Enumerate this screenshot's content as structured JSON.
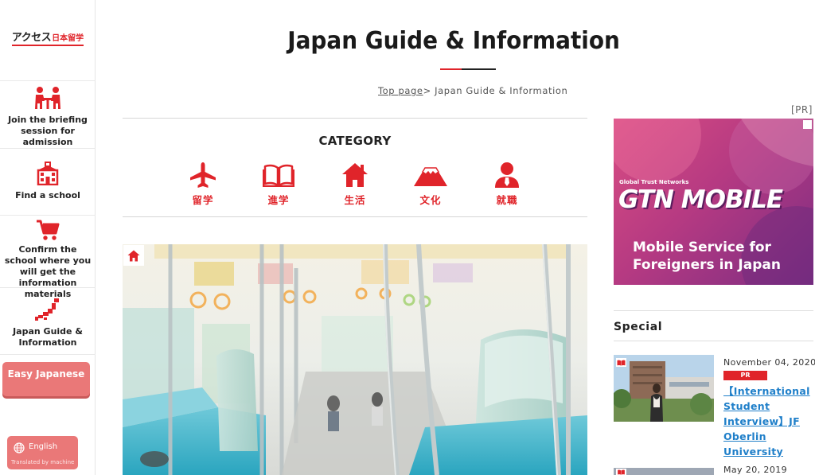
{
  "sidebar": {
    "logo_katakana": "アクセス",
    "logo_kanji": "日本留学",
    "items": [
      {
        "label": "Join the briefing session for admission",
        "icon": "meeting-icon"
      },
      {
        "label": "Find a school",
        "icon": "school-building-icon"
      },
      {
        "label": "Confirm the school where you will get the information materials",
        "icon": "shopping-cart-icon"
      },
      {
        "label": "Japan Guide & Information",
        "icon": "japan-map-icon"
      }
    ],
    "easy_japanese": "Easy Japanese",
    "language": {
      "label": "English",
      "note": "Translated by machine",
      "icon": "globe-icon"
    }
  },
  "header": {
    "title": "Japan Guide & Information",
    "breadcrumb_link": "Top page",
    "breadcrumb_current": "> Japan Guide & Information"
  },
  "category": {
    "title": "CATEGORY",
    "items": [
      {
        "label": "留学",
        "icon": "airplane-icon"
      },
      {
        "label": "進学",
        "icon": "book-icon"
      },
      {
        "label": "生活",
        "icon": "home-icon"
      },
      {
        "label": "文化",
        "icon": "mount-fuji-icon"
      },
      {
        "label": "就職",
        "icon": "person-icon"
      }
    ]
  },
  "hero": {
    "icon": "home-icon"
  },
  "ad": {
    "pr_label": "[PR]",
    "small_text": "Global Trust Networks",
    "brand": "GTN MOBILE",
    "tagline": "Mobile Service for Foreigners in Japan"
  },
  "special": {
    "title": "Special",
    "items": [
      {
        "date": "November 04, 2020",
        "badge": "PR",
        "title": "【International Student Interview】JF Oberlin University",
        "icon": "book-icon"
      },
      {
        "date": "May 20, 2019",
        "icon": "book-icon"
      }
    ]
  },
  "colors": {
    "accent": "#e0242a",
    "button_pink": "#ea7878",
    "link_blue": "#1f7fc9",
    "ad_pink": "#d94d83"
  }
}
